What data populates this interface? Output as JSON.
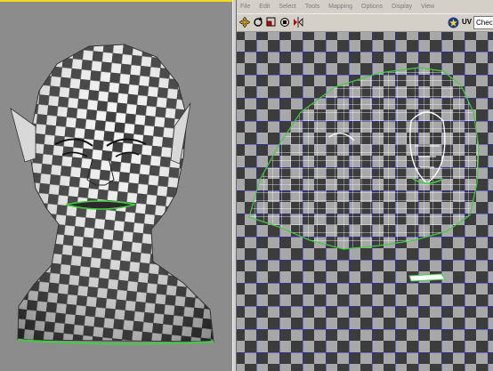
{
  "uv_editor": {
    "menu": [
      "File",
      "Edit",
      "Select",
      "Tools",
      "Mapping",
      "Options",
      "Display",
      "View"
    ],
    "toolbar": {
      "uv_label": "UV",
      "texture_selected": "Checker"
    }
  },
  "colors": {
    "viewport_background": "#8c8c8c",
    "active_viewport_border": "#f2dc1a",
    "uv_grid": "#2a2ad0",
    "seam": "#3ecf3e",
    "uv_wire": "#ffffff",
    "checker_dark": "#3c3c3c",
    "checker_light": "#a8a8a8"
  }
}
